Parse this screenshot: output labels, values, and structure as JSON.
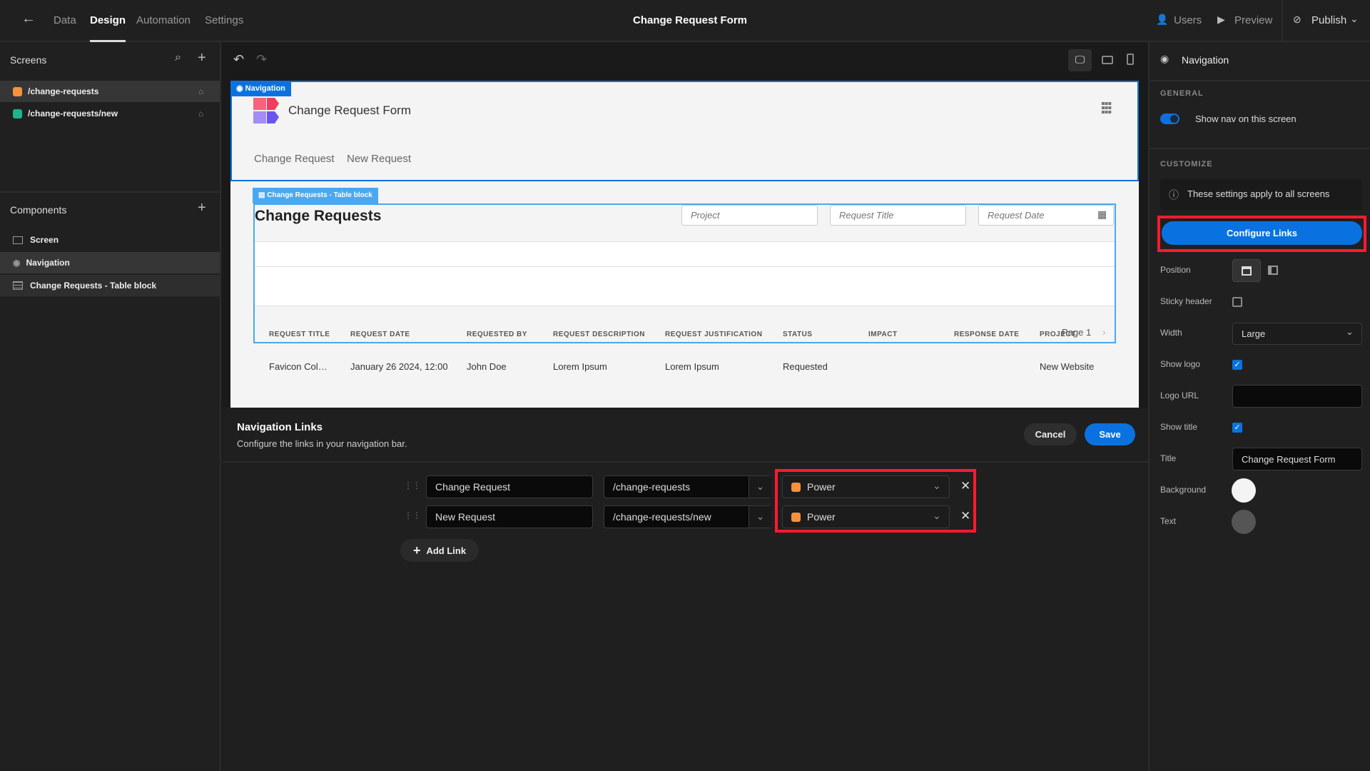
{
  "topbar": {
    "tabs": [
      "Data",
      "Design",
      "Automation",
      "Settings"
    ],
    "active_tab": "Design",
    "title": "Change Request Form",
    "users": "Users",
    "preview": "Preview",
    "publish": "Publish"
  },
  "sidebar": {
    "screens_title": "Screens",
    "screens": [
      {
        "path": "/change-requests",
        "color": "#f7913e"
      },
      {
        "path": "/change-requests/new",
        "color": "#1fb48a"
      }
    ],
    "components_title": "Components",
    "components": [
      "Screen",
      "Navigation",
      "Change Requests - Table block"
    ]
  },
  "preview": {
    "nav_tag": "Navigation",
    "app_title": "Change Request Form",
    "nav_links": [
      "Change Request",
      "New Request"
    ],
    "table_tag": "Change Requests - Table block",
    "table_title": "Change Requests",
    "filters": [
      "Project",
      "Request Title",
      "Request Date"
    ],
    "columns": [
      "REQUEST TITLE",
      "REQUEST DATE",
      "REQUESTED BY",
      "REQUEST DESCRIPTION",
      "REQUEST JUSTIFICATION",
      "STATUS",
      "IMPACT",
      "RESPONSE DATE",
      "PROJECT"
    ],
    "rows": [
      [
        "Favicon Col…",
        "January 26 2024, 12:00",
        "John Doe",
        "Lorem Ipsum",
        "Lorem Ipsum",
        "Requested",
        "",
        "",
        "New Website"
      ]
    ],
    "page": "Page 1"
  },
  "links_panel": {
    "title": "Navigation Links",
    "subtitle": "Configure the links in your navigation bar.",
    "cancel": "Cancel",
    "save": "Save",
    "add": "Add Link",
    "links": [
      {
        "label": "Change Request",
        "url": "/change-requests",
        "role": "Power"
      },
      {
        "label": "New Request",
        "url": "/change-requests/new",
        "role": "Power"
      }
    ],
    "role_color": "#f7913e"
  },
  "settings": {
    "header": "Navigation",
    "general": "GENERAL",
    "show_nav": "Show nav on this screen",
    "show_nav_on": true,
    "customize": "CUSTOMIZE",
    "info": "These settings apply to all screens",
    "configure": "Configure Links",
    "position": "Position",
    "sticky": "Sticky header",
    "sticky_on": false,
    "width": "Width",
    "width_value": "Large",
    "show_logo": "Show logo",
    "show_logo_on": true,
    "logo_url": "Logo URL",
    "logo_url_value": "",
    "show_title": "Show title",
    "show_title_on": true,
    "title": "Title",
    "title_value": "Change Request Form",
    "background": "Background",
    "background_color": "#f4f4f4",
    "text": "Text",
    "text_color": "#555555"
  },
  "accent": "#0a72e0"
}
